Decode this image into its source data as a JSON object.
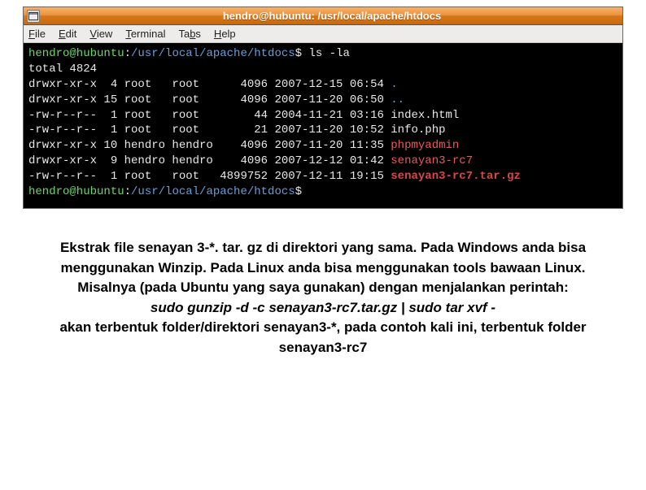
{
  "window": {
    "title": "hendro@hubuntu: /usr/local/apache/htdocs"
  },
  "menu": {
    "file": "File",
    "edit": "Edit",
    "view": "View",
    "terminal": "Terminal",
    "tabs": "Tabs",
    "help": "Help"
  },
  "terminal": {
    "prompt_user_host": "hendro@hubuntu",
    "prompt_path": "/usr/local/apache/htdocs",
    "prompt_sep": ":",
    "prompt_end": "$ ",
    "cmd1": "ls -la",
    "total_label": "total",
    "total_value": "4824",
    "rows": [
      {
        "perm": "drwxr-xr-x",
        "links": " 4",
        "owner": "root  ",
        "group": "root  ",
        "size": "   4096",
        "date": "2007-12-15",
        "time": "06:54",
        "name": ".",
        "cls": "term-blue"
      },
      {
        "perm": "drwxr-xr-x",
        "links": "15",
        "owner": "root  ",
        "group": "root  ",
        "size": "   4096",
        "date": "2007-11-20",
        "time": "06:50",
        "name": "..",
        "cls": "term-blue"
      },
      {
        "perm": "-rw-r--r--",
        "links": " 1",
        "owner": "root  ",
        "group": "root  ",
        "size": "     44",
        "date": "2004-11-21",
        "time": "03:16",
        "name": "index.html",
        "cls": "term-white"
      },
      {
        "perm": "-rw-r--r--",
        "links": " 1",
        "owner": "root  ",
        "group": "root  ",
        "size": "     21",
        "date": "2007-11-20",
        "time": "10:52",
        "name": "info.php",
        "cls": "term-white"
      },
      {
        "perm": "drwxr-xr-x",
        "links": "10",
        "owner": "hendro",
        "group": "hendro",
        "size": "   4096",
        "date": "2007-11-20",
        "time": "11:35",
        "name": "phpmyadmin",
        "cls": "term-red"
      },
      {
        "perm": "drwxr-xr-x",
        "links": " 9",
        "owner": "hendro",
        "group": "hendro",
        "size": "   4096",
        "date": "2007-12-12",
        "time": "01:42",
        "name": "senayan3-rc7",
        "cls": "term-red"
      },
      {
        "perm": "-rw-r--r--",
        "links": " 1",
        "owner": "root  ",
        "group": "root  ",
        "size": "4899752",
        "date": "2007-12-11",
        "time": "19:15",
        "name": "senayan3-rc7.tar.gz",
        "cls": "term-red-bold"
      }
    ]
  },
  "caption": {
    "p1": "Ekstrak file senayan 3-*. tar. gz di direktori yang sama. Pada Windows anda bisa menggunakan Winzip. Pada Linux anda bisa menggunakan tools bawaan Linux. Misalnya (pada Ubuntu yang saya gunakan) dengan menjalankan perintah:",
    "cmd": "sudo gunzip -d -c senayan3-rc7.tar.gz | sudo tar xvf -",
    "p2": "akan terbentuk folder/direktori senayan3-*, pada contoh kali ini, terbentuk folder senayan3-rc7"
  }
}
